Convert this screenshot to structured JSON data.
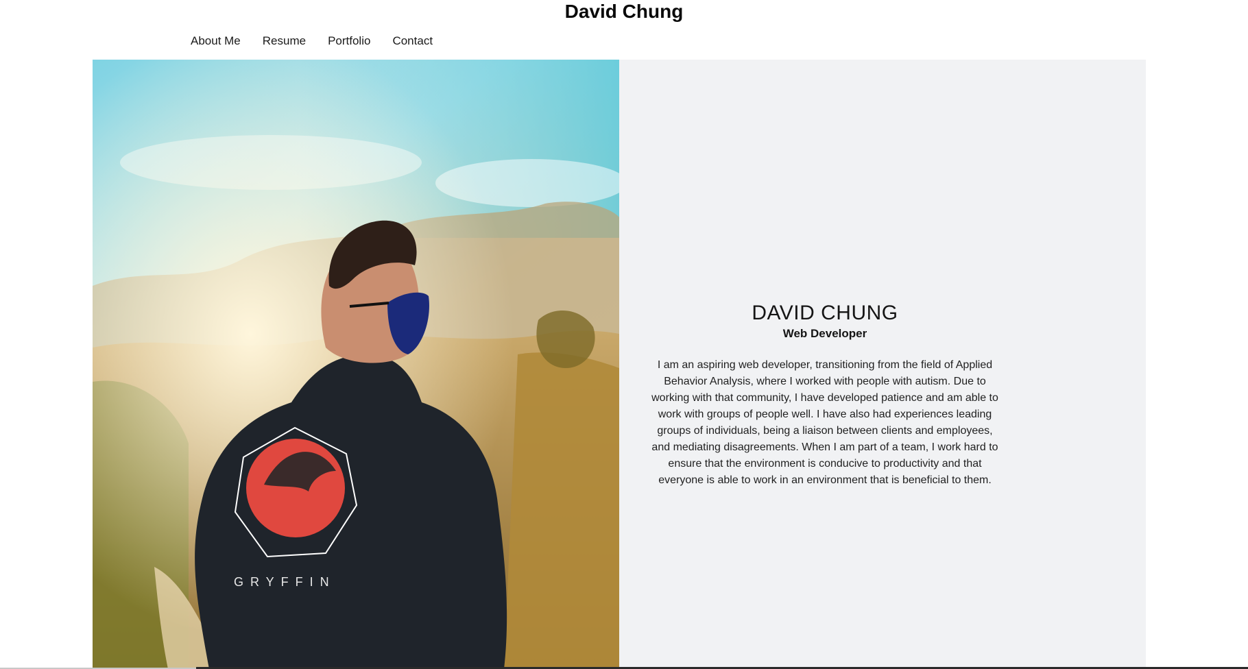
{
  "site": {
    "title": "David Chung"
  },
  "nav": {
    "items": [
      {
        "label": "About Me"
      },
      {
        "label": "Resume"
      },
      {
        "label": "Portfolio"
      },
      {
        "label": "Contact"
      }
    ]
  },
  "hero": {
    "photo": {
      "hoodie_text": "GRYFFIN"
    },
    "about": {
      "name": "DAVID CHUNG",
      "role": "Web Developer",
      "bio": "I am an aspiring web developer, transitioning from the field of Applied Behavior Analysis, where I worked with people with autism. Due to working with that community, I have developed patience and am able to work with groups of people well. I have also had experiences leading groups of individuals, being a liaison between clients and employees, and mediating disagreements. When I am part of a team, I work hard to ensure that the environment is conducive to productivity and that everyone is able to work in an environment that is beneficial to them."
    }
  },
  "colors": {
    "panel_bg": "#f1f2f4",
    "sky_top": "#52c7dc",
    "hoodie": "#1f242b",
    "emblem_red": "#e0483f"
  }
}
